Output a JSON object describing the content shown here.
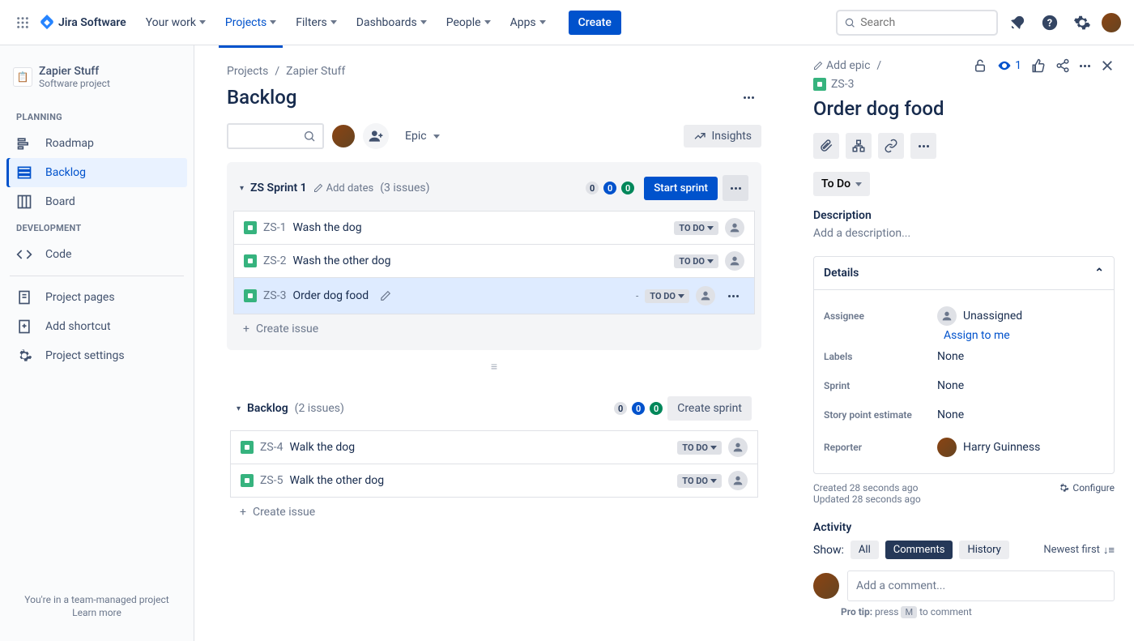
{
  "brand": "Jira Software",
  "nav": {
    "yourwork": "Your work",
    "projects": "Projects",
    "filters": "Filters",
    "dashboards": "Dashboards",
    "people": "People",
    "apps": "Apps",
    "create": "Create"
  },
  "search_placeholder": "Search",
  "project": {
    "name": "Zapier Stuff",
    "type": "Software project"
  },
  "sidebar": {
    "planning": "PLANNING",
    "roadmap": "Roadmap",
    "backlog": "Backlog",
    "board": "Board",
    "development": "DEVELOPMENT",
    "code": "Code",
    "pages": "Project pages",
    "shortcut": "Add shortcut",
    "settings": "Project settings",
    "footer1": "You're in a team-managed project",
    "footer2": "Learn more"
  },
  "breadcrumb": {
    "projects": "Projects",
    "project": "Zapier Stuff"
  },
  "page_title": "Backlog",
  "epic_label": "Epic",
  "insights": "Insights",
  "sprint": {
    "name": "ZS Sprint 1",
    "add_dates": "Add dates",
    "count": "(3 issues)",
    "badges": {
      "gray": "0",
      "blue": "0",
      "green": "0"
    },
    "start": "Start sprint",
    "issues": [
      {
        "key": "ZS-1",
        "summary": "Wash the dog",
        "status": "TO DO",
        "selected": false
      },
      {
        "key": "ZS-2",
        "summary": "Wash the other dog",
        "status": "TO DO",
        "selected": false
      },
      {
        "key": "ZS-3",
        "summary": "Order dog food",
        "status": "TO DO",
        "selected": true
      }
    ]
  },
  "create_issue": "Create issue",
  "backlog": {
    "name": "Backlog",
    "count": "(2 issues)",
    "badges": {
      "gray": "0",
      "blue": "0",
      "green": "0"
    },
    "create_sprint": "Create sprint",
    "issues": [
      {
        "key": "ZS-4",
        "summary": "Walk the dog",
        "status": "TO DO"
      },
      {
        "key": "ZS-5",
        "summary": "Walk the other dog",
        "status": "TO DO"
      }
    ]
  },
  "detail": {
    "add_epic": "Add epic",
    "watchers": "1",
    "key": "ZS-3",
    "title": "Order dog food",
    "status": "To Do",
    "description_h": "Description",
    "description_ph": "Add a description...",
    "details_h": "Details",
    "fields": {
      "assignee_l": "Assignee",
      "assignee_v": "Unassigned",
      "assign_link": "Assign to me",
      "labels_l": "Labels",
      "labels_v": "None",
      "sprint_l": "Sprint",
      "sprint_v": "None",
      "sp_l": "Story point estimate",
      "sp_v": "None",
      "reporter_l": "Reporter",
      "reporter_v": "Harry Guinness"
    },
    "created": "Created 28 seconds ago",
    "updated": "Updated 28 seconds ago",
    "configure": "Configure",
    "activity_h": "Activity",
    "show": "Show:",
    "tabs": {
      "all": "All",
      "comments": "Comments",
      "history": "History"
    },
    "newest": "Newest first",
    "comment_ph": "Add a comment...",
    "protip_pre": "Pro tip:",
    "protip_mid": " press ",
    "protip_key": "M",
    "protip_post": " to comment"
  }
}
